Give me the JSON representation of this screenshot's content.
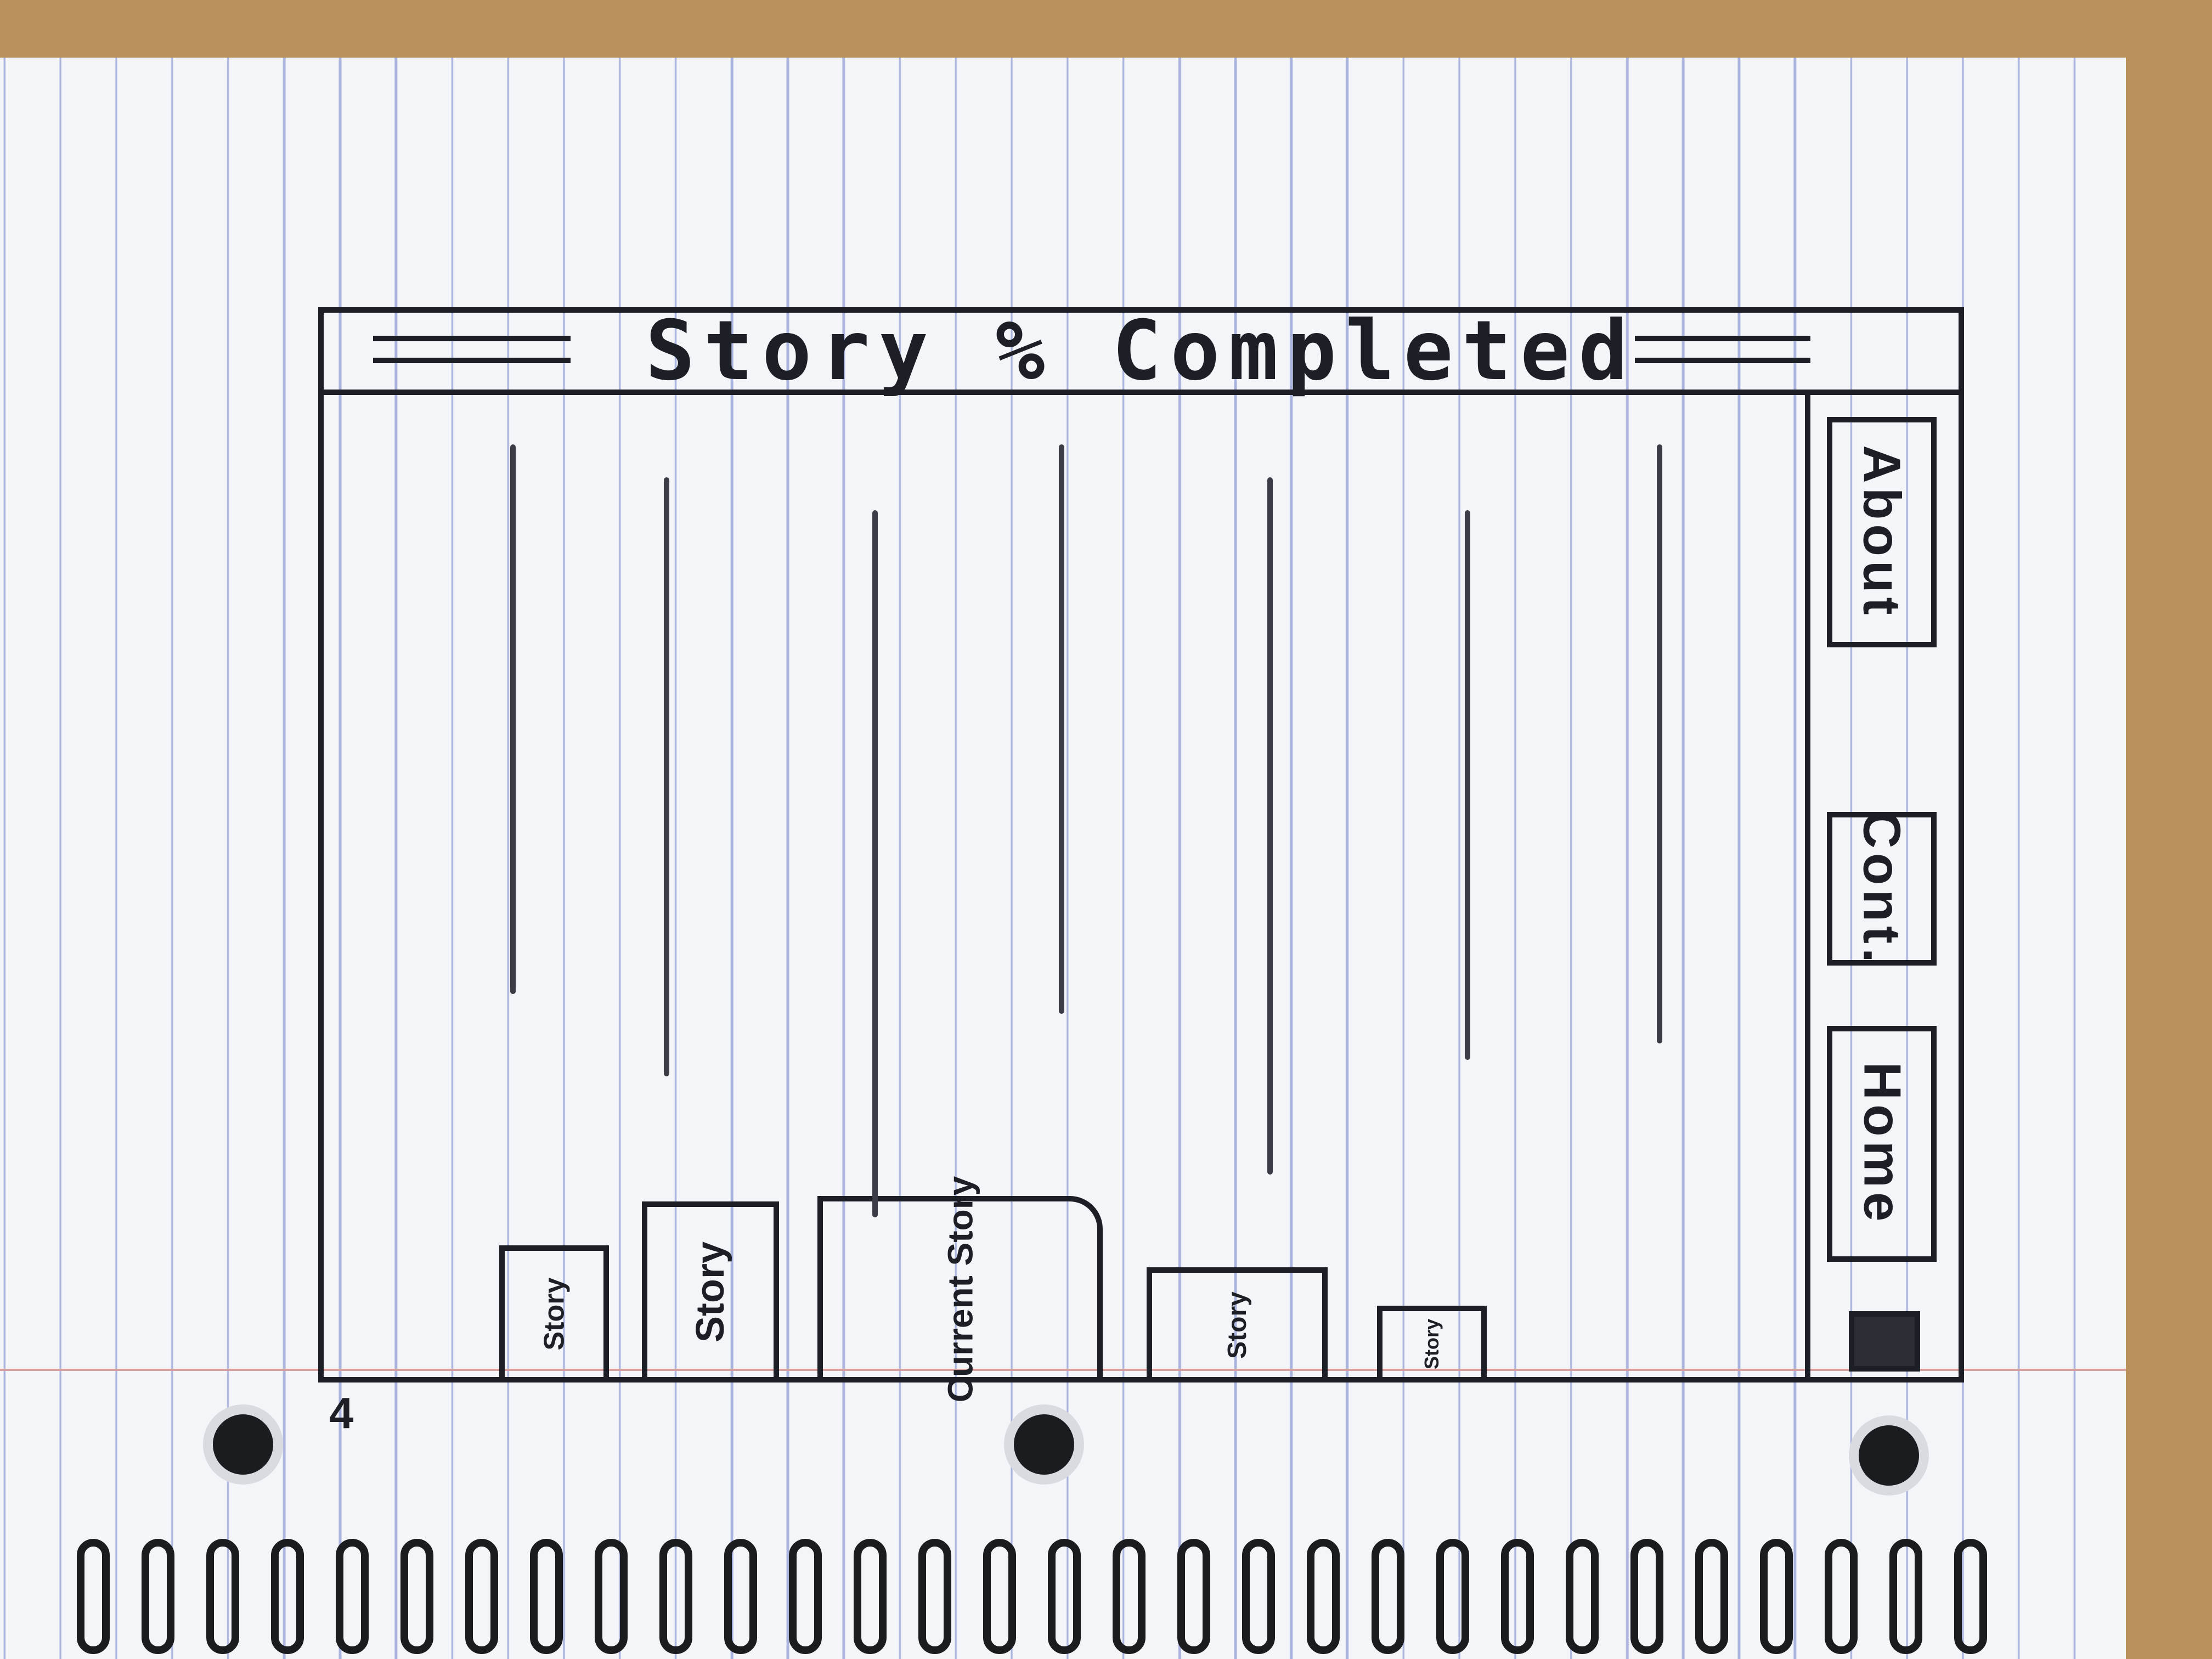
{
  "header": {
    "title": "Story % Completed"
  },
  "stories": [
    {
      "label": "Story",
      "completion": 0.56
    },
    {
      "label": "Story",
      "completion": 0.61
    },
    {
      "label": "Current Story",
      "completion": 0.72
    },
    {
      "label": "Story",
      "completion": 0.58
    },
    {
      "label": "Story",
      "completion": 0.71
    }
  ],
  "sidebar": {
    "items": [
      {
        "label": "About"
      },
      {
        "label": "Cont."
      },
      {
        "label": "Home"
      }
    ]
  },
  "footer": {
    "page_number": "4"
  },
  "colors": {
    "ink": "#1d1f26",
    "paper": "#f4f5f8",
    "rule_line": "#a9b3dd",
    "margin_line": "#d9a0a0",
    "table": "#b98f5c"
  }
}
